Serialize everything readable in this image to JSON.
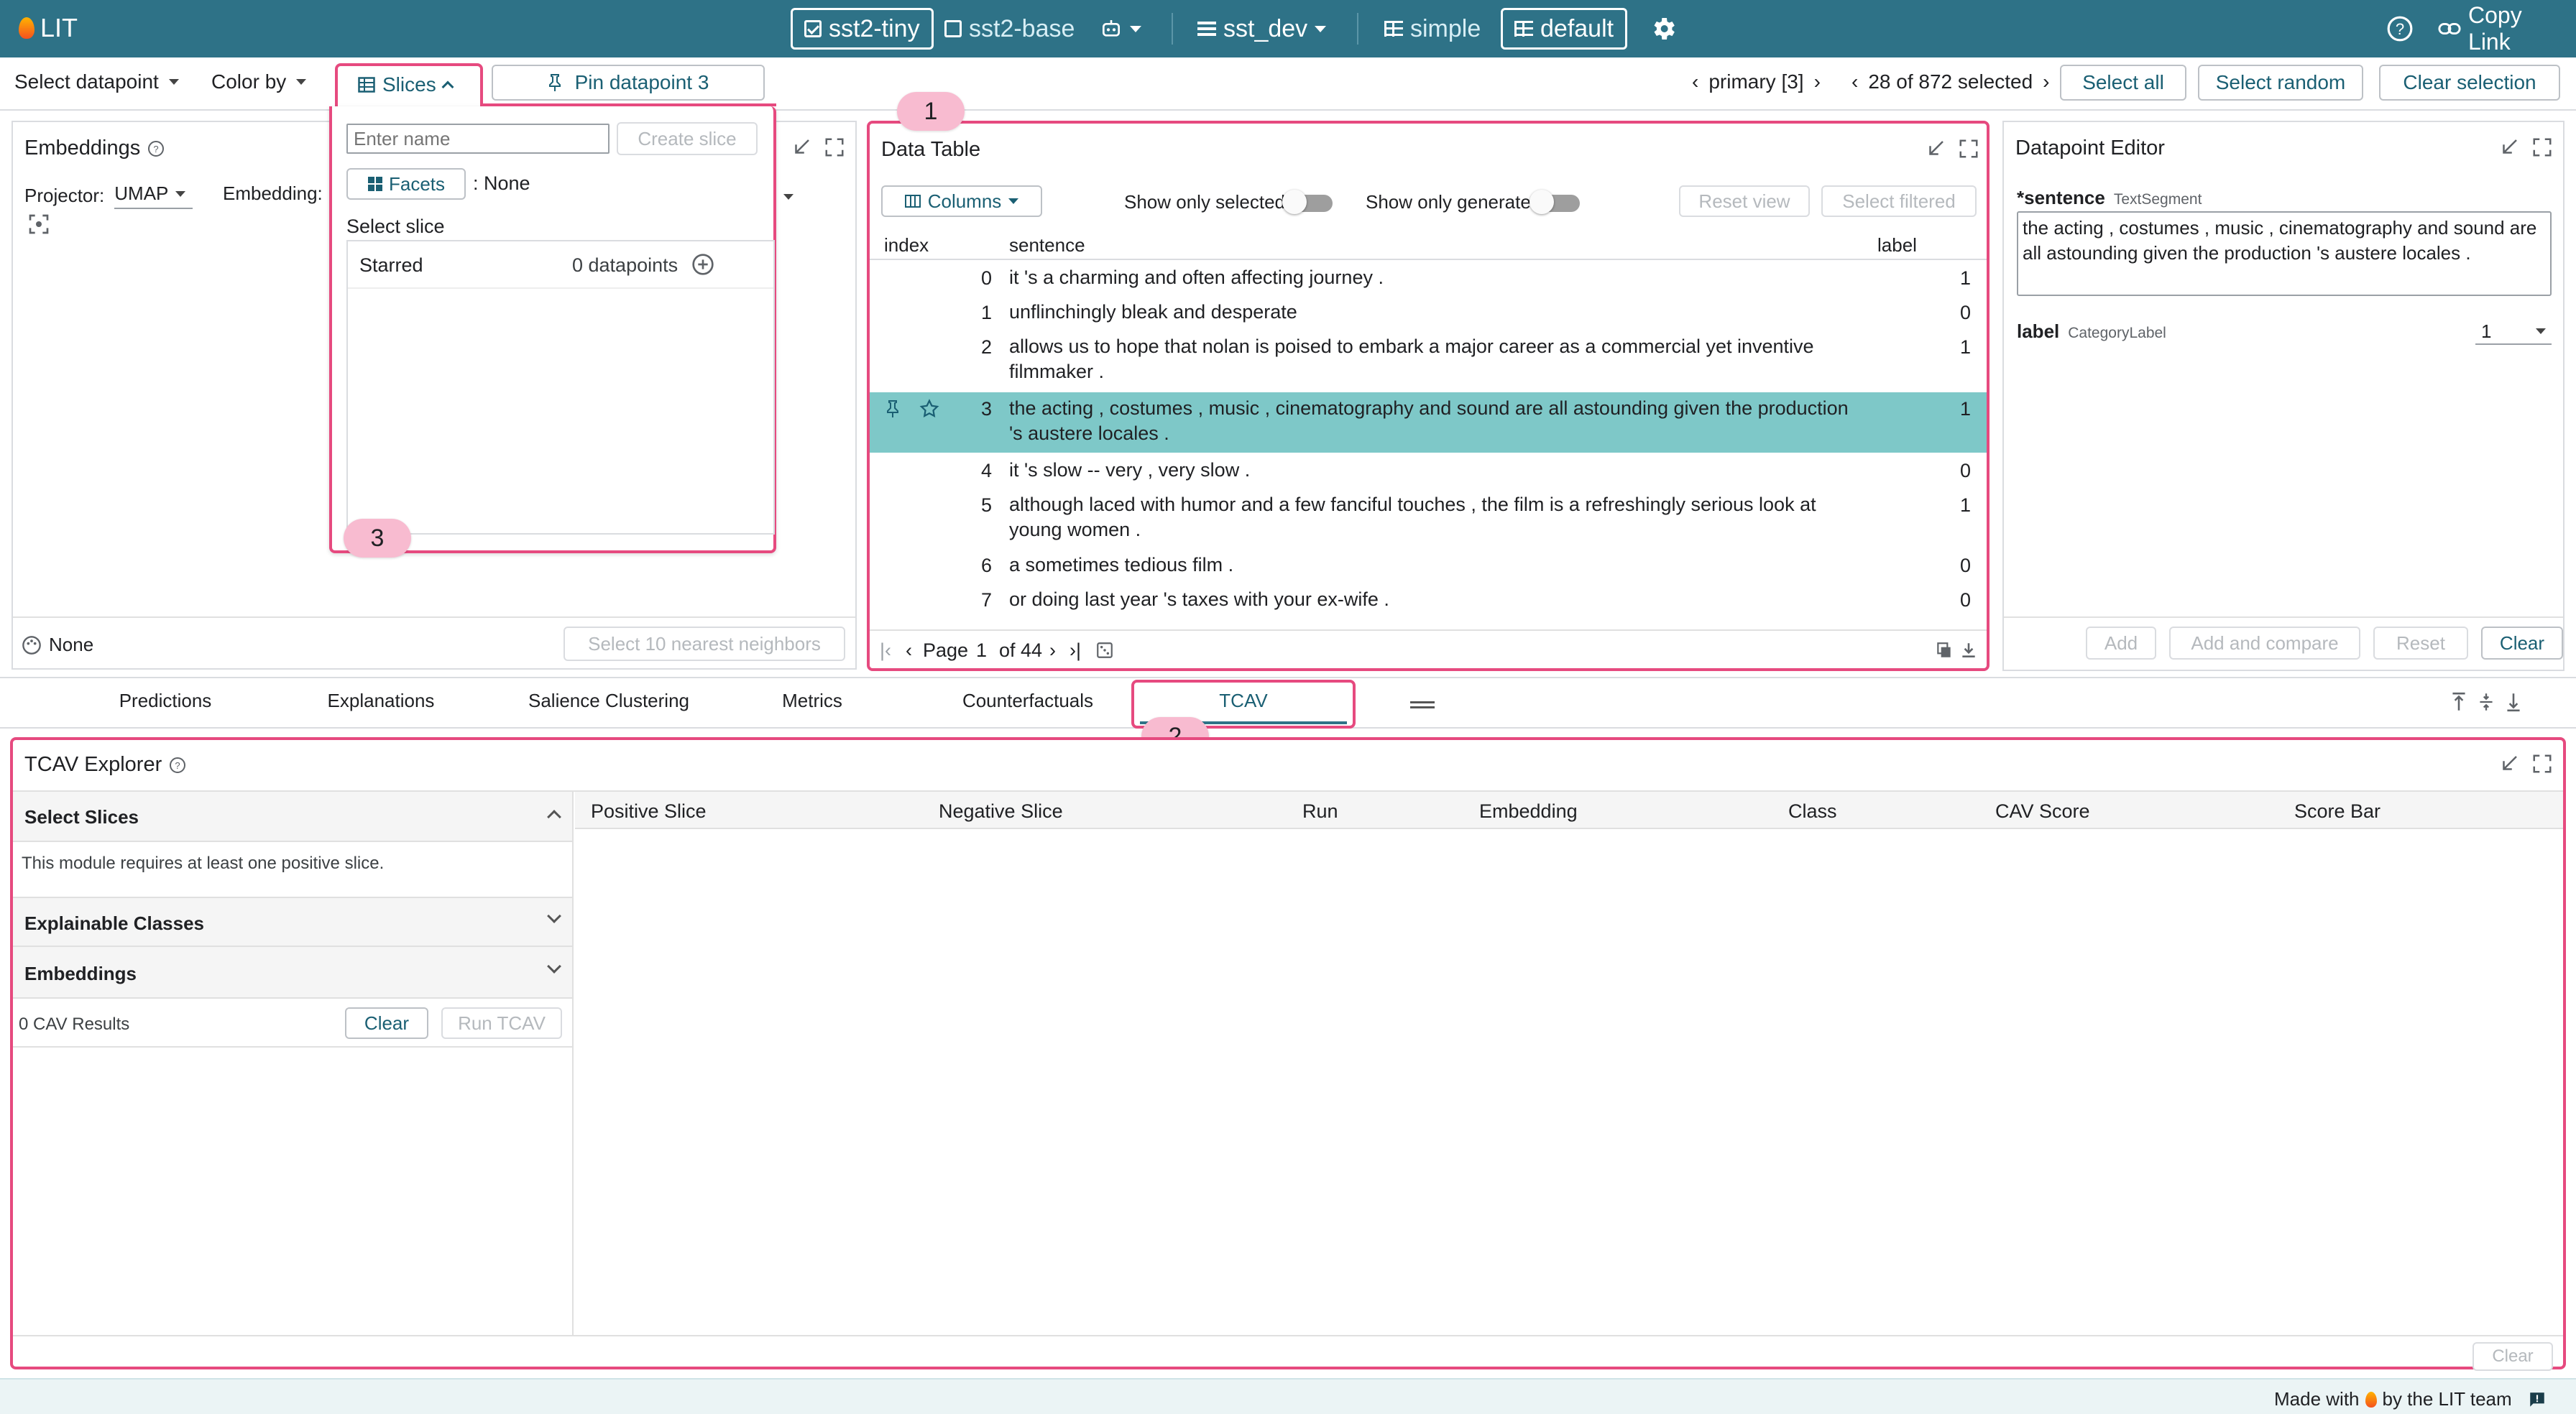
{
  "app": {
    "title": "LIT"
  },
  "topbar": {
    "models": [
      {
        "label": "sst2-tiny",
        "selected": true
      },
      {
        "label": "sst2-base",
        "selected": false
      }
    ],
    "dataset": "sst_dev",
    "layouts": [
      {
        "label": "simple",
        "selected": false
      },
      {
        "label": "default",
        "selected": true
      }
    ],
    "copy_link": "Copy Link"
  },
  "toolbar": {
    "select_datapoint": "Select datapoint",
    "color_by": "Color by",
    "slices": "Slices",
    "pin_datapoint": "Pin datapoint 3",
    "primary": "primary [3]",
    "selected_count": "28 of 872 selected",
    "select_all": "Select all",
    "select_random": "Select random",
    "clear_selection": "Clear selection"
  },
  "slices_popup": {
    "name_placeholder": "Enter name",
    "create_slice": "Create slice",
    "facets": "Facets",
    "facets_value": ": None",
    "select_slice": "Select slice",
    "slices": [
      {
        "name": "Starred",
        "count": "0 datapoints"
      }
    ]
  },
  "embeddings": {
    "title": "Embeddings",
    "projector_label": "Projector:",
    "projector_value": "UMAP",
    "embedding_label": "Embedding:",
    "color_none": "None",
    "nearest_neighbors": "Select 10 nearest neighbors"
  },
  "data_table": {
    "title": "Data Table",
    "columns_button": "Columns",
    "show_only_selected": "Show only selected",
    "show_only_generated": "Show only generated",
    "reset_view": "Reset view",
    "select_filtered": "Select filtered",
    "headers": {
      "index": "index",
      "sentence": "sentence",
      "label": "label"
    },
    "rows": [
      {
        "index": "0",
        "sentence": "it 's a charming and often affecting journey .",
        "label": "1"
      },
      {
        "index": "1",
        "sentence": "unflinchingly bleak and desperate",
        "label": "0"
      },
      {
        "index": "2",
        "sentence": "allows us to hope that nolan is poised to embark a major career as a commercial yet inventive filmmaker .",
        "label": "1"
      },
      {
        "index": "3",
        "sentence": "the acting , costumes , music , cinematography and sound are all astounding given the production 's austere locales .",
        "label": "1",
        "selected": true
      },
      {
        "index": "4",
        "sentence": "it 's slow -- very , very slow .",
        "label": "0"
      },
      {
        "index": "5",
        "sentence": "although laced with humor and a few fanciful touches , the film is a refreshingly serious look at young women .",
        "label": "1"
      },
      {
        "index": "6",
        "sentence": "a sometimes tedious film .",
        "label": "0"
      },
      {
        "index": "7",
        "sentence": "or doing last year 's taxes with your ex-wife .",
        "label": "0"
      }
    ],
    "page_label": "Page",
    "page_current": "1",
    "page_total": "of 44"
  },
  "datapoint_editor": {
    "title": "Datapoint Editor",
    "sentence_label": "*sentence",
    "sentence_type": "TextSegment",
    "sentence_value": "the acting , costumes , music , cinematography and sound are all astounding given the production 's austere locales .",
    "label_label": "label",
    "label_type": "CategoryLabel",
    "label_value": "1",
    "add": "Add",
    "add_and_compare": "Add and compare",
    "reset": "Reset",
    "clear": "Clear"
  },
  "tabs": [
    {
      "label": "Predictions"
    },
    {
      "label": "Explanations"
    },
    {
      "label": "Salience Clustering"
    },
    {
      "label": "Metrics"
    },
    {
      "label": "Counterfactuals"
    },
    {
      "label": "TCAV",
      "active": true
    }
  ],
  "tcav": {
    "title": "TCAV Explorer",
    "select_slices": "Select Slices",
    "requirement": "This module requires at least one positive slice.",
    "explainable_classes": "Explainable Classes",
    "embeddings": "Embeddings",
    "results": "0 CAV Results",
    "clear": "Clear",
    "run": "Run TCAV",
    "headers": [
      "Positive Slice",
      "Negative Slice",
      "Run",
      "Embedding",
      "Class",
      "CAV Score",
      "Score Bar"
    ],
    "footer_clear": "Clear"
  },
  "annotations": {
    "badge1": "1",
    "badge2": "2",
    "badge3": "3"
  },
  "footer": {
    "made_with": "Made with",
    "by_team": "by the LIT team"
  },
  "colors": {
    "header": "#2e7287",
    "accent": "#1a5f73",
    "highlight": "#e64a7f",
    "badge": "#f8bbd0",
    "selected_row": "#7ec8c8"
  }
}
